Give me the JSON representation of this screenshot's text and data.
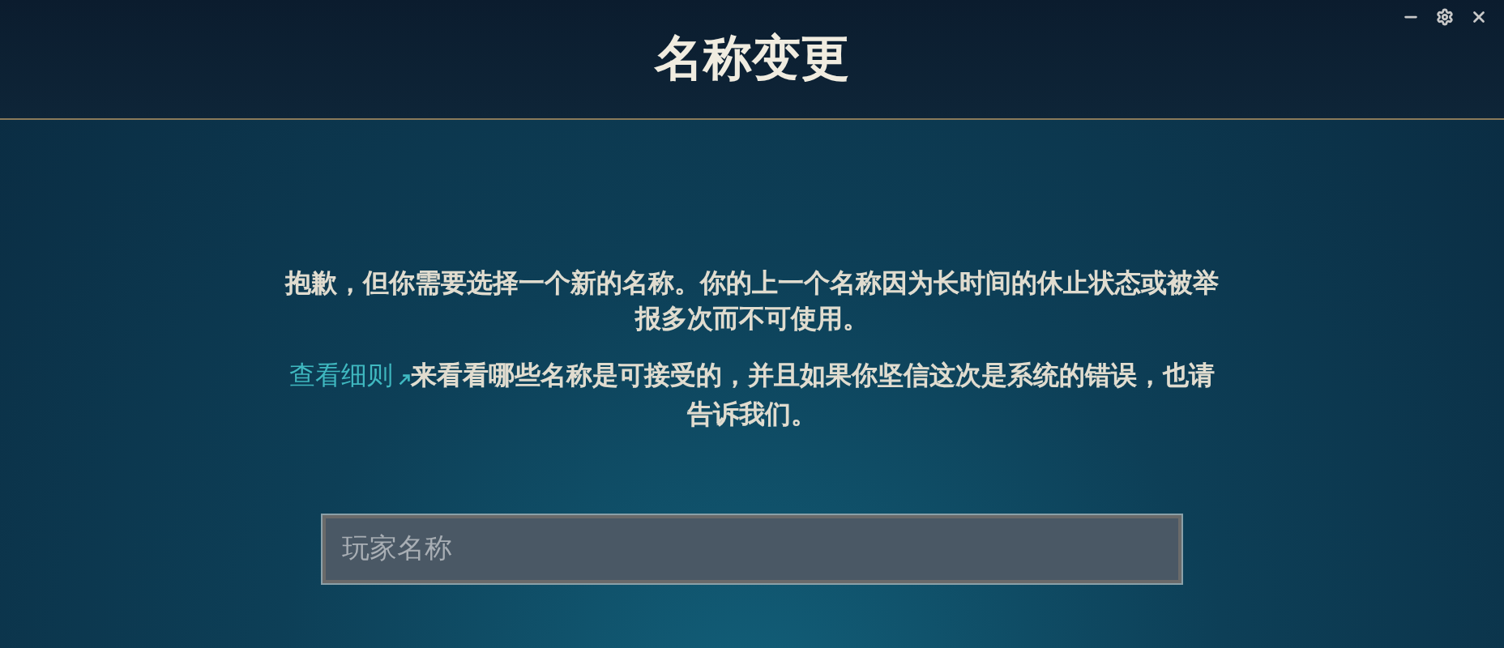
{
  "window": {
    "title": "名称变更"
  },
  "message": "抱歉，但你需要选择一个新的名称。你的上一个名称因为长时间的休止状态或被举报多次而不可使用。",
  "details": {
    "link": "查看细则",
    "text": "来看看哪些名称是可接受的，并且如果你坚信这次是系统的错误，也请告诉我们。"
  },
  "name_field": {
    "placeholder": "玩家名称"
  }
}
